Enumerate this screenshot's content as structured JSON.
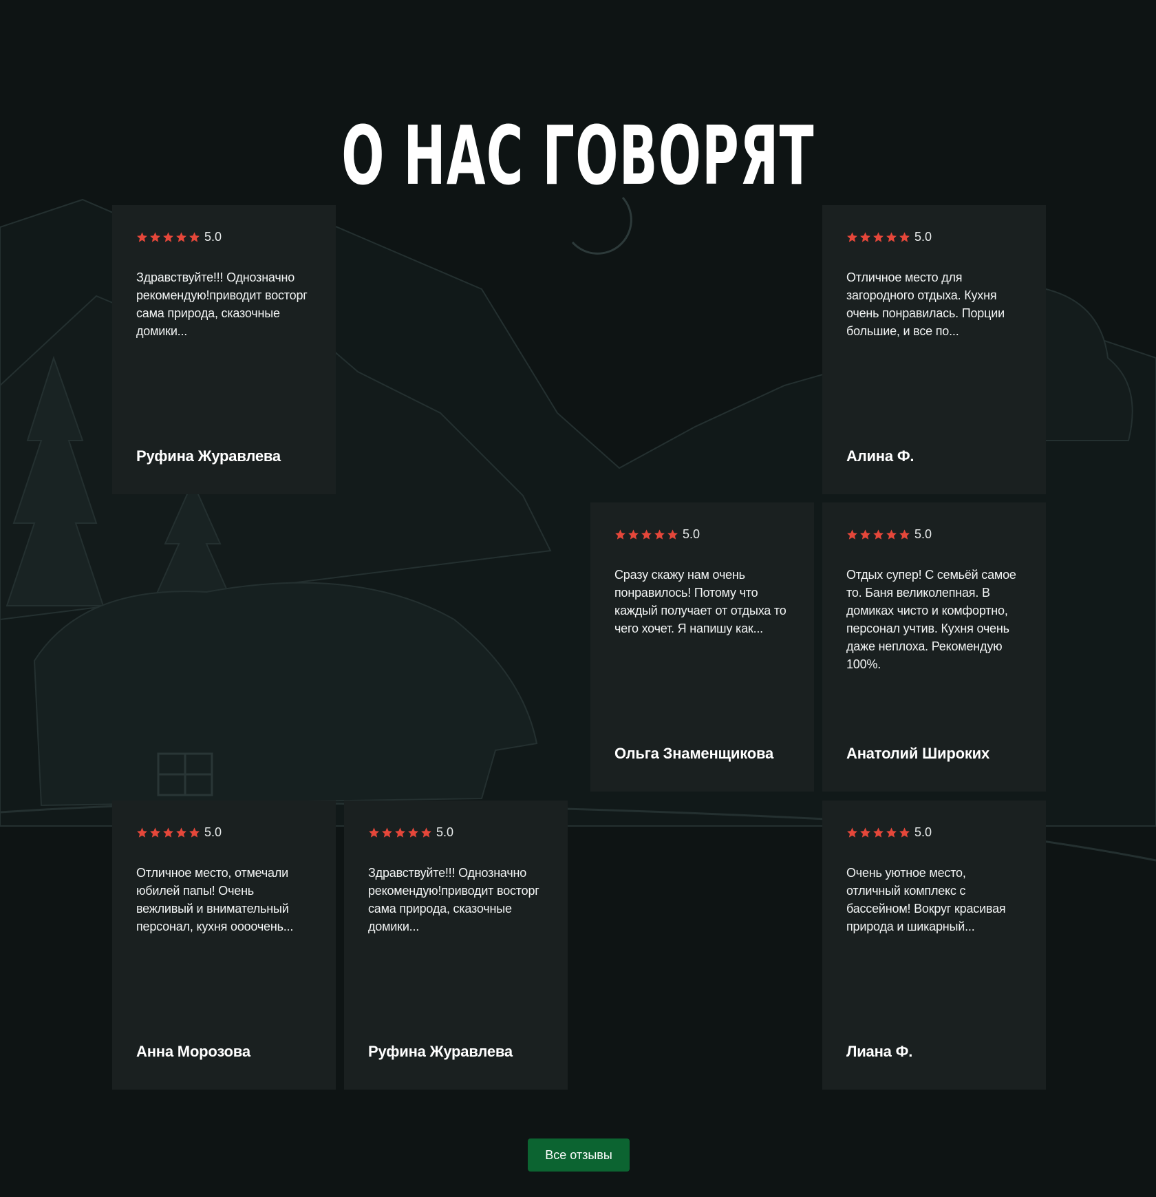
{
  "section": {
    "title": "О НАС ГОВОРЯТ",
    "all_reviews_label": "Все отзывы"
  },
  "colors": {
    "background": "#0e1414",
    "card": "#1a2020",
    "star": "#e5473a",
    "button": "#0c6431"
  },
  "reviews": [
    {
      "rating": "5.0",
      "stars": 5,
      "text": "Здравствуйте!!! Однозначно рекомендую!приводит восторг сама природа, сказочные домики...",
      "author": "Руфина Журавлева"
    },
    {
      "rating": "5.0",
      "stars": 5,
      "text": "Отличное место для загородного отдыха. Кухня очень понравилась. Порции большие, и все по...",
      "author": "Алина Ф."
    },
    {
      "rating": "5.0",
      "stars": 5,
      "text": "Сразу скажу нам очень понравилось! Потому что каждый получает от отдыха то чего хочет. Я напишу как...",
      "author": "Ольга Знаменщикова"
    },
    {
      "rating": "5.0",
      "stars": 5,
      "text": "Отдых супер! С семьёй самое то. Баня великолепная. В домиках чисто и комфортно, персонал учтив. Кухня очень даже неплоха. Рекомендую 100%.",
      "author": "Анатолий Широких"
    },
    {
      "rating": "5.0",
      "stars": 5,
      "text": "Отличное место, отмечали юбилей папы! Очень вежливый и внимательный персонал, кухня оооочень...",
      "author": "Анна Морозова"
    },
    {
      "rating": "5.0",
      "stars": 5,
      "text": "Здравствуйте!!! Однозначно рекомендую!приводит восторг сама природа, сказочные домики...",
      "author": "Руфина Журавлева"
    },
    {
      "rating": "5.0",
      "stars": 5,
      "text": "Очень уютное место, отличный комплекс с бассейном! Вокруг красивая природа и шикарный...",
      "author": "Лиана Ф."
    }
  ]
}
